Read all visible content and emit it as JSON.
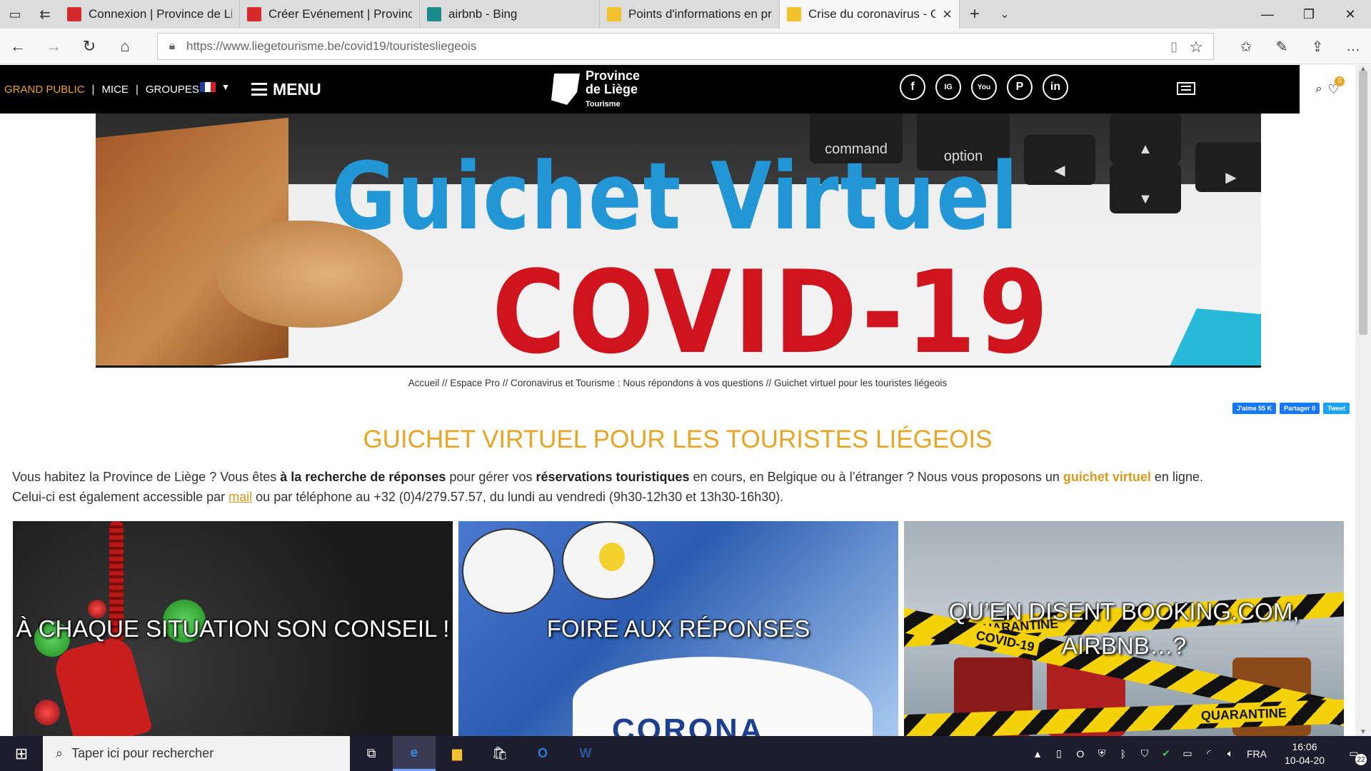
{
  "browser": {
    "tabs": [
      {
        "title": "Connexion | Province de Liè",
        "favicon_color": "#d42a2a",
        "active": false
      },
      {
        "title": "Créer Evénement | Province",
        "favicon_color": "#d42a2a",
        "active": false
      },
      {
        "title": "airbnb - Bing",
        "favicon_color": "#1a8a8a",
        "active": false
      },
      {
        "title": "Points d'informations en prc",
        "favicon_color": "#f2c12e",
        "active": false
      },
      {
        "title": "Crise du coronavirus - C",
        "favicon_color": "#f2c12e",
        "active": true
      }
    ],
    "url_host": "https://www.liegetourisme.be",
    "url_path": "/covid19/touristesliegeois"
  },
  "header": {
    "audience": [
      {
        "label": "GRAND PUBLIC",
        "current": true
      },
      {
        "label": "MICE",
        "current": false
      },
      {
        "label": "GROUPES",
        "current": false
      }
    ],
    "menu_label": "MENU",
    "logo": {
      "line1": "Province",
      "line2": "de Liège",
      "line3": "Tourisme"
    },
    "social": [
      "f",
      "IG",
      "You",
      "P",
      "in"
    ],
    "favorites_count": "0"
  },
  "hero": {
    "key_labels": [
      "command",
      "option"
    ],
    "title_line1": "Guichet Virtuel",
    "title_line2": "COVID-19"
  },
  "breadcrumb": "Accueil // Espace Pro // Coronavirus et Tourisme : Nous répondons à vos questions // Guichet virtuel pour les touristes liégeois",
  "share": {
    "like": "J'aime 55 K",
    "share": "Partager 0",
    "tweet": "Tweet"
  },
  "page": {
    "title": "GUICHET VIRTUEL POUR LES TOURISTES LIÉGEOIS",
    "intro": {
      "p1a": "Vous habitez la Province de Liège ? Vous êtes ",
      "p1b": "à la recherche de réponses",
      "p1c": " pour gérer vos ",
      "p1d": "réservations touristiques",
      "p1e": " en cours, en Belgique ou à l’étranger ? Nous vous proposons un ",
      "p1f": "guichet virtuel",
      "p1g": " en ligne.",
      "p2a": "Celui-ci est également accessible par ",
      "p2b": "mail",
      "p2c": " ou par téléphone au +32 (0)4/279.57.57, du lundi au vendredi (9h30-12h30 et 13h30-16h30)."
    }
  },
  "cards": [
    {
      "label": "À CHAQUE SITUATION SON CONSEIL !"
    },
    {
      "label": "FOIRE AUX RÉPONSES",
      "image_text": "CORONA VIRUS"
    },
    {
      "label": "QU’EN DISENT BOOKING.COM, AIRBNB…?",
      "tape_texts": [
        "QUARANTINE",
        "QUARANTINE",
        "COVID-19",
        "QUARANTINE"
      ]
    }
  ],
  "taskbar": {
    "search_placeholder": "Taper ici pour rechercher",
    "lang": "FRA",
    "time": "16:06",
    "date": "10-04-20",
    "notifications": "22"
  }
}
